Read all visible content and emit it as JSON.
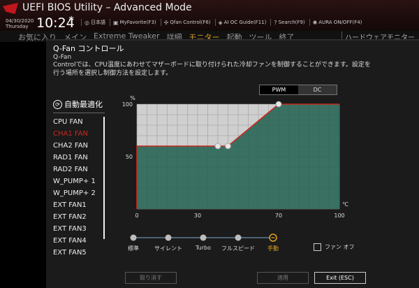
{
  "header": {
    "title": "UEFI BIOS Utility – Advanced Mode",
    "date": "04/30/2020",
    "day": "Thursday",
    "time": "10:24",
    "toolbar": [
      {
        "icon": "globe-icon",
        "label": "日本語"
      },
      {
        "icon": "star-icon",
        "label": "MyFavorite(F3)"
      },
      {
        "icon": "fan-icon",
        "label": "Qfan Control(F6)"
      },
      {
        "icon": "ai-icon",
        "label": "AI OC Guide(F11)"
      },
      {
        "icon": "question-icon",
        "label": "Search(F9)"
      },
      {
        "icon": "aura-icon",
        "label": "AURA ON/OFF(F4)"
      }
    ]
  },
  "menu": {
    "tabs": [
      "お気に入り",
      "メイン",
      "Extreme Tweaker",
      "詳細",
      "モニター",
      "起動",
      "ツール",
      "終了"
    ],
    "active_index": 4,
    "right_label": "ハードウェアモニター"
  },
  "page": {
    "title": "Q-Fan コントロール",
    "section": "Q-Fan",
    "description": "Controlでは、CPU温度にあわせてマザーボードに取り付けられた冷却ファンを制御することができます。設定を行う場所を選択し制御方法を設定します。"
  },
  "sidebar": {
    "auto_optimize": "自動最適化",
    "fans": [
      "CPU FAN",
      "CHA1 FAN",
      "CHA2 FAN",
      "RAD1 FAN",
      "RAD2 FAN",
      "W_PUMP+ 1",
      "W_PUMP+ 2",
      "EXT FAN1",
      "EXT FAN2",
      "EXT FAN3",
      "EXT FAN4",
      "EXT FAN5"
    ],
    "active_index": 1
  },
  "mode_toggle": {
    "options": [
      "PWM",
      "DC"
    ],
    "selected": "PWM"
  },
  "chart_data": {
    "type": "line",
    "xlabel": "℃",
    "ylabel": "%",
    "xlim": [
      0,
      100
    ],
    "ylim": [
      0,
      100
    ],
    "x_ticks": [
      0,
      30,
      70,
      100
    ],
    "y_ticks": [
      50,
      100
    ],
    "series": [
      {
        "points": [
          [
            0,
            0
          ],
          [
            0,
            60
          ],
          [
            40,
            60
          ],
          [
            45,
            60
          ],
          [
            70,
            100
          ],
          [
            100,
            100
          ]
        ]
      }
    ],
    "control_points": [
      [
        40,
        60
      ],
      [
        45,
        60
      ],
      [
        70,
        100
      ]
    ],
    "line_color": "#c8281e",
    "fill_color": "#1f5f4f"
  },
  "presets": {
    "items": [
      "標準",
      "サイレント",
      "Turbo",
      "フルスピード",
      "手動"
    ],
    "selected_index": 4
  },
  "fan_off": {
    "label": "ファン オフ",
    "checked": false
  },
  "buttons": {
    "cancel": "取り消す",
    "apply": "適用",
    "exit": "Exit (ESC)"
  }
}
